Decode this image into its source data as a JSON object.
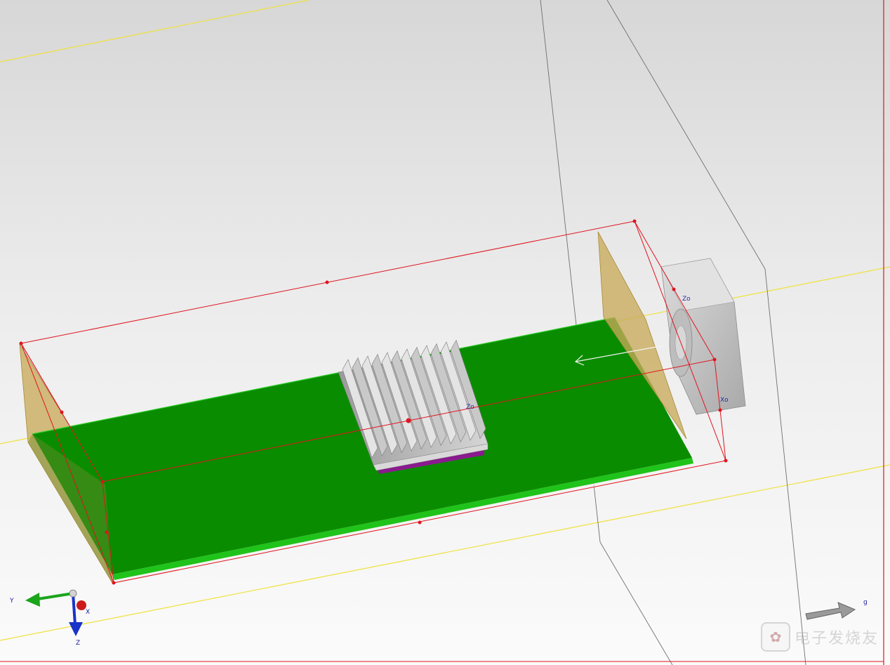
{
  "view": {
    "background_top": "#d7d7d7",
    "background_bottom": "#fbfbfb",
    "selection_color": "#e0141e",
    "board_color": "#0a8c00",
    "board_edge_color": "#22c41a",
    "heatsink_color": "#b8b8b8",
    "component_color": "#8a1a8f",
    "opening_color": "#c8aa5a",
    "fan_color": "#c9c9c9",
    "cabinet_line_color": "#6e6e6e",
    "grid_line_color": "#f0e43a"
  },
  "triad": {
    "y_label": "Y",
    "z_label": "Z",
    "x_label": "X",
    "y_color": "#1aa51a",
    "z_color": "#1a33c8",
    "x_color": "#cc1a1a"
  },
  "labels": {
    "heatsink": "Zo",
    "fan_top": "Zo",
    "fan_side": "Xo",
    "gravity": "g"
  },
  "watermark": {
    "text": "电子发烧友",
    "icon": "logo-icon"
  }
}
